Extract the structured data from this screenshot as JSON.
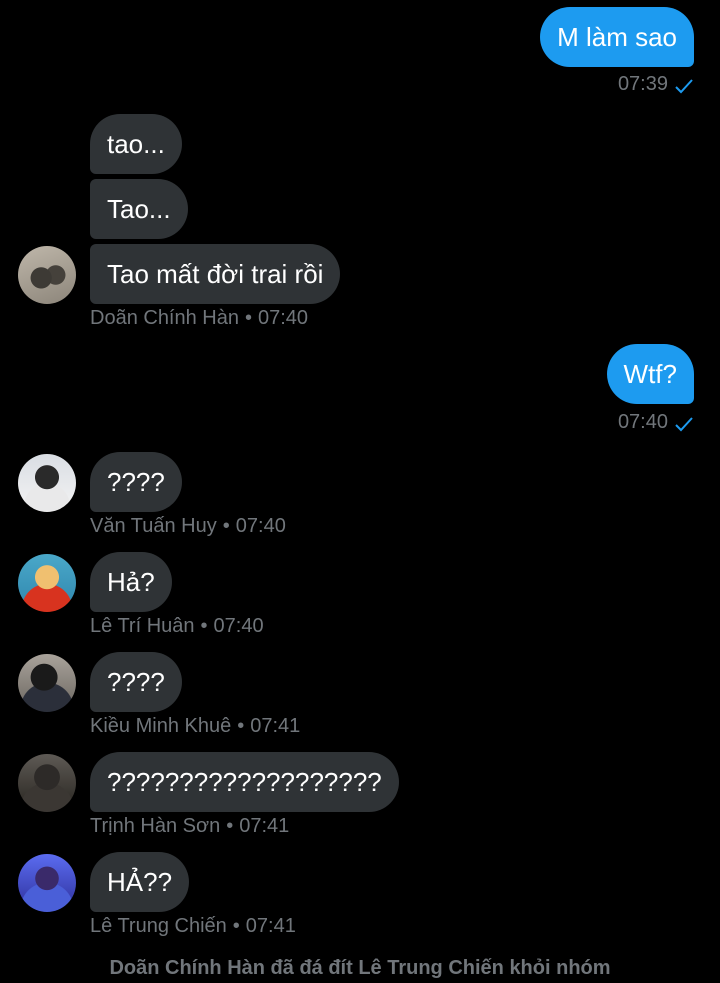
{
  "messages": {
    "m1": {
      "text": "M làm sao",
      "time": "07:39"
    },
    "g1": {
      "lines": [
        "tao...",
        "Tao...",
        "Tao mất đời trai rồi"
      ],
      "sender": "Doãn Chính Hàn",
      "time": "07:40"
    },
    "m2": {
      "text": "Wtf?",
      "time": "07:40"
    },
    "g2": {
      "text": "????",
      "sender": "Văn Tuấn Huy",
      "time": "07:40"
    },
    "g3": {
      "text": "Hả?",
      "sender": "Lê Trí Huân",
      "time": "07:40"
    },
    "g4": {
      "text": "????",
      "sender": "Kiều Minh Khuê",
      "time": "07:41"
    },
    "g5": {
      "text": "???????????????????",
      "sender": "Trịnh Hàn Sơn",
      "time": "07:41"
    },
    "g6": {
      "text": "HẢ??",
      "sender": "Lê Trung Chiến",
      "time": "07:41"
    }
  },
  "separator": "•",
  "system_message": "Doãn Chính Hàn đã đá đít Lê Trung Chiến khỏi nhóm",
  "colors": {
    "background": "#000000",
    "outgoing_bubble": "#1d9bf0",
    "incoming_bubble": "#2f3336",
    "meta_text": "#71767b",
    "read_check": "#1d9bf0"
  },
  "icons": {
    "read_receipt": "checkmark-icon"
  }
}
